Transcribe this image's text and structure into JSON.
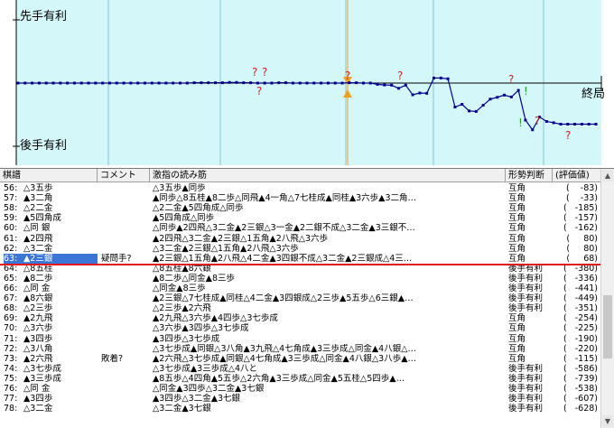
{
  "graph": {
    "label_top": "先手有利",
    "label_bottom": "後手有利",
    "label_end": "終局",
    "colors": {
      "bg": "#ffffff",
      "band": "#d4f8fa",
      "line": "#00008b",
      "cursor": "#f0a020",
      "question": "#d02020",
      "bang": "#20a020"
    }
  },
  "columns": {
    "kifu": "棋譜",
    "comment": "コメント",
    "reading": "激指の読み筋",
    "judgment": "形勢判断",
    "value": "(評価値)"
  },
  "rows": [
    {
      "num": "56:",
      "move": "△3五歩",
      "comment": "",
      "reading": "△3五歩▲同歩",
      "judgment": "互角",
      "value": "-83"
    },
    {
      "num": "57:",
      "move": "▲3二角",
      "comment": "",
      "reading": "▲同歩△8五桂▲8二歩△同飛▲4一角△7七桂成▲同桂▲3六歩▲3二角…",
      "judgment": "互角",
      "value": "-33"
    },
    {
      "num": "58:",
      "move": "△2二金",
      "comment": "",
      "reading": "△2二金▲5四角成△同歩",
      "judgment": "互角",
      "value": "-185"
    },
    {
      "num": "59:",
      "move": "▲5四角成",
      "comment": "",
      "reading": "▲5四角成△同歩",
      "judgment": "互角",
      "value": "-157"
    },
    {
      "num": "60:",
      "move": "△同 銀",
      "comment": "",
      "reading": "△同歩▲2四飛△3二金▲2三銀△3一金▲2二銀不成△3二金▲3三銀不…",
      "judgment": "互角",
      "value": "-162"
    },
    {
      "num": "61:",
      "move": "▲2四飛",
      "comment": "",
      "reading": "▲2四飛△3二金▲2三銀△1五角▲2八飛△3六歩",
      "judgment": "互角",
      "value": "80"
    },
    {
      "num": "62:",
      "move": "△3二金",
      "comment": "",
      "reading": "△3二金▲2三銀△1五角▲2八飛△3六歩",
      "judgment": "互角",
      "value": "80"
    },
    {
      "num": "63:",
      "move": "▲2三銀",
      "comment": "疑問手?",
      "reading": "▲2三銀△1五角▲2八飛△4二金▲3四銀不成△3二金▲2三銀成△4三…",
      "judgment": "互角",
      "value": "68"
    },
    {
      "num": "64:",
      "move": "△8五桂",
      "comment": "",
      "reading": "△8五桂▲8六銀",
      "judgment": "後手有利",
      "value": "-380"
    },
    {
      "num": "65:",
      "move": "▲8二歩",
      "comment": "",
      "reading": "▲8二歩△同金▲8三歩",
      "judgment": "後手有利",
      "value": "-336"
    },
    {
      "num": "66:",
      "move": "△同 金",
      "comment": "",
      "reading": "△同金▲8三歩",
      "judgment": "後手有利",
      "value": "-441"
    },
    {
      "num": "67:",
      "move": "▲8六銀",
      "comment": "",
      "reading": "▲2三銀△7七桂成▲同桂△4二金▲3四銀成△2三歩▲5五歩△6三銀▲…",
      "judgment": "後手有利",
      "value": "-449"
    },
    {
      "num": "68:",
      "move": "△2三歩",
      "comment": "",
      "reading": "△2三歩▲2六飛",
      "judgment": "後手有利",
      "value": "-351"
    },
    {
      "num": "69:",
      "move": "▲2九飛",
      "comment": "",
      "reading": "▲2九飛△3六歩▲4四歩△3七歩成",
      "judgment": "互角",
      "value": "-254"
    },
    {
      "num": "70:",
      "move": "△3六歩",
      "comment": "",
      "reading": "△3六歩▲3四歩△3七歩成",
      "judgment": "互角",
      "value": "-225"
    },
    {
      "num": "71:",
      "move": "▲3四歩",
      "comment": "",
      "reading": "▲3四歩△3七歩成",
      "judgment": "互角",
      "value": "-190"
    },
    {
      "num": "72:",
      "move": "△3八角",
      "comment": "",
      "reading": "△3七歩成▲同銀△3八角▲3九飛△4七角成▲3三歩成△同金▲4八銀△…",
      "judgment": "互角",
      "value": "-220"
    },
    {
      "num": "73:",
      "move": "▲2六飛",
      "comment": "敗着?",
      "reading": "▲2六飛△3七歩成▲同銀△4七角成▲3三歩成△同金▲4八銀△3八歩▲…",
      "judgment": "互角",
      "value": "-115"
    },
    {
      "num": "74:",
      "move": "△3七歩成",
      "comment": "",
      "reading": "△3七歩成▲3三歩成△4八と",
      "judgment": "後手有利",
      "value": "-586"
    },
    {
      "num": "75:",
      "move": "▲3三歩成",
      "comment": "",
      "reading": "▲8五歩△4四角▲5五歩△2六角▲3三歩成△同金▲5五桂△5四歩▲…",
      "judgment": "後手有利",
      "value": "-739"
    },
    {
      "num": "76:",
      "move": "△同 金",
      "comment": "",
      "reading": "△同金▲3四歩△3二金▲3七銀",
      "judgment": "後手有利",
      "value": "-538"
    },
    {
      "num": "77:",
      "move": "▲3四歩",
      "comment": "",
      "reading": "▲3四歩△3二金▲3七銀",
      "judgment": "後手有利",
      "value": "-607"
    },
    {
      "num": "78:",
      "move": "△3二金",
      "comment": "",
      "reading": "△3二金▲3七銀",
      "judgment": "後手有利",
      "value": "-628"
    }
  ],
  "selected_row": 7,
  "eval_points": [
    0,
    0,
    0,
    0,
    0,
    0,
    0,
    0,
    0,
    0,
    0,
    0,
    0,
    0,
    0,
    0,
    0,
    0,
    0,
    0,
    0,
    0,
    0,
    0,
    0,
    5,
    5,
    5,
    5,
    5,
    10,
    10,
    5,
    5,
    0,
    0,
    0,
    5,
    5,
    0,
    0,
    0,
    0,
    0,
    0,
    0,
    0,
    5,
    5,
    0,
    0,
    -20,
    -30,
    -33,
    -83,
    -33,
    -185,
    -157,
    -162,
    80,
    80,
    68,
    -380,
    -336,
    -441,
    -449,
    -351,
    -254,
    -225,
    -190,
    -220,
    -115,
    -586,
    -739,
    -538,
    -607,
    -628,
    -650,
    -650,
    -650,
    -650,
    -650,
    -650
  ]
}
